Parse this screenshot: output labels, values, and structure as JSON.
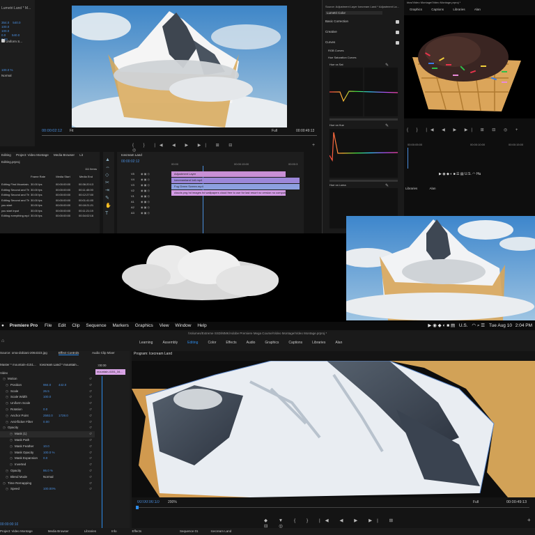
{
  "collage": {
    "top_left": {
      "panel_header": "Lumetri Land * M...",
      "effect_rows": [
        {
          "name": "Uniform S...",
          "value": ""
        },
        {
          "name": "Normal",
          "value": "100.0 %"
        }
      ],
      "program_timecode": "00:00:02:12",
      "fit_label": "Fit",
      "full_label": "Full",
      "end_timecode": "00:00:49:13",
      "project_tabs": [
        "Editing",
        "Project: Video Montage",
        "Media Browser",
        "Lit"
      ],
      "project_file": "Editing.prproj",
      "item_count": "111 Items",
      "columns": [
        "Frame Rate",
        "Media Start",
        "Media End"
      ],
      "rows": [
        {
          "name": "Editing First Mountain.ot",
          "rate": "30.00 fps",
          "start": "00:00:00:00",
          "end": "00:36:20:13"
        },
        {
          "name": "Editing Second and Third",
          "rate": "30.00 fps",
          "start": "00:00:00:00",
          "end": "00:11:40:00"
        },
        {
          "name": "Editing Second and Third",
          "rate": "30.00 fps",
          "start": "00:00:00:00",
          "end": "00:12:27:00"
        },
        {
          "name": "Editing Second and Third",
          "rate": "30.00 fps",
          "start": "00:00:00:00",
          "end": "00:01:41:00"
        },
        {
          "name": "you start",
          "rate": "30.00 fps",
          "start": "00:00:00:00",
          "end": "00:18:21:21"
        },
        {
          "name": "you start input",
          "rate": "30.00 fps",
          "start": "00:00:00:00",
          "end": "00:11:21:19"
        },
        {
          "name": "Editing everything.mp4",
          "rate": "30.00 fps",
          "start": "00:00:00:00",
          "end": "00:34:02:16"
        }
      ],
      "sequence_tab": "Icecream Land",
      "sequence_timecode": "00:00:02:12",
      "ruler_labels": [
        "00:00",
        "00:00:15:00",
        "00:00:3"
      ],
      "tracks": [
        "V5",
        "V4",
        "V3",
        "V2",
        "V1",
        "A1",
        "A2",
        "A3"
      ],
      "clips": [
        {
          "label": "Adjustment Layer",
          "color": "#c98fd6"
        },
        {
          "label": "icecreamland 1x6.mp4",
          "color": "#9c87d9"
        },
        {
          "label": "Fog Green Screen.mp4",
          "color": "#8da0e0"
        },
        {
          "label": "clouds png hd images hd wallpapers cloud free to use for last resort no version no computers at the",
          "color": "#d39be5"
        }
      ]
    },
    "lumetri": {
      "header": "Source: Adjustment Layer  Icecream Land * Adjustment La...",
      "preset": "Lumetri Color",
      "sections": [
        "Basic Correction",
        "Creative",
        "Curves"
      ],
      "subsections": [
        "RGB Curves",
        "Hue Saturation Curves"
      ],
      "curve_labels": [
        "Hue vs Sat",
        "Hue vs Hue",
        "Hue vs Luma"
      ]
    },
    "top_right": {
      "header": "ktos/Video Montage/Video Montage.prproj *",
      "tabs": [
        "Graphics",
        "Captions",
        "Libraries",
        "Alan"
      ],
      "ruler_labels": [
        "00:00:05:00",
        "00:00:10:00",
        "00:00:15:00"
      ],
      "tabs2": [
        "Libraries",
        "Alan"
      ],
      "menubar_right": [
        "U.S.",
        "Hu"
      ]
    },
    "bottom_main": {
      "menubar": {
        "apple": "",
        "app": "Premiere Pro",
        "items": [
          "File",
          "Edit",
          "Clip",
          "Sequence",
          "Markers",
          "Graphics",
          "View",
          "Window",
          "Help"
        ],
        "right_status": [
          "U.S.",
          "Tue Aug 10",
          "2:04 PM"
        ]
      },
      "path": "/Volumes/Extreme SSD/MMK/Adobe Premiere Mega Course/Video Montage/Video Montage.prproj *",
      "workspace_tabs": [
        "Learning",
        "Assembly",
        "Editing",
        "Color",
        "Effects",
        "Audio",
        "Graphics",
        "Captions",
        "Libraries",
        "Alan"
      ],
      "active_workspace": "Editing",
      "ec_tabs": [
        "Source: oma-dobiani-2064323.jpg",
        "Effect Controls",
        "Audio Clip Mixer"
      ],
      "ec_source": "Master * mountain-4151...",
      "ec_seq": "Icecream Land * mountain...",
      "ec_clip_label": "mountain-4151_34...",
      "ec_time_start": ":00:00",
      "section_video": "Video",
      "properties": [
        {
          "name": "Motion",
          "v1": "",
          "v2": ""
        },
        {
          "name": "Position",
          "v1": "984.0",
          "v2": "442.0"
        },
        {
          "name": "Scale",
          "v1": "26.5",
          "v2": ""
        },
        {
          "name": "Scale Width",
          "v1": "100.0",
          "v2": ""
        },
        {
          "name": "Uniform Scale",
          "v1": "",
          "v2": ""
        },
        {
          "name": "Rotation",
          "v1": "0.0",
          "v2": ""
        },
        {
          "name": "Anchor Point",
          "v1": "2592.0",
          "v2": "1728.0"
        },
        {
          "name": "Anti-flicker Filter",
          "v1": "0.00",
          "v2": ""
        },
        {
          "name": "Opacity",
          "v1": "",
          "v2": ""
        },
        {
          "name": "Mask (1)",
          "v1": "",
          "v2": ""
        },
        {
          "name": "Mask Path",
          "v1": "",
          "v2": ""
        },
        {
          "name": "Mask Feather",
          "v1": "10.0",
          "v2": ""
        },
        {
          "name": "Mask Opacity",
          "v1": "100.0 %",
          "v2": ""
        },
        {
          "name": "Mask Expansion",
          "v1": "0.0",
          "v2": ""
        },
        {
          "name": "Inverted",
          "v1": "",
          "v2": ""
        },
        {
          "name": "Opacity",
          "v1": "86.0 %",
          "v2": ""
        },
        {
          "name": "Blend Mode",
          "v1": "Normal",
          "v2": ""
        },
        {
          "name": "Time Remapping",
          "v1": "",
          "v2": ""
        },
        {
          "name": "Speed",
          "v1": "100.00%",
          "v2": ""
        }
      ],
      "ec_bottom_timecode": "00:00:00:10",
      "program_title": "Program: Icecream Land",
      "program_timecode": "00:00:00:10",
      "zoom": "200%",
      "full": "Full",
      "end_timecode": "00:00:49:13",
      "bottom_tabs_left": [
        "Project: Video Montage",
        "Media Browser",
        "Libraries",
        "Info",
        "Effects"
      ],
      "bottom_tabs_right": [
        "Sequence 01",
        "Icecream Land"
      ]
    },
    "colors": {
      "accent_blue": "#2d8ceb",
      "timecode_blue": "#4a8fe0",
      "sky": "#4f8fd0",
      "clip_pink": "#d39be5"
    }
  }
}
